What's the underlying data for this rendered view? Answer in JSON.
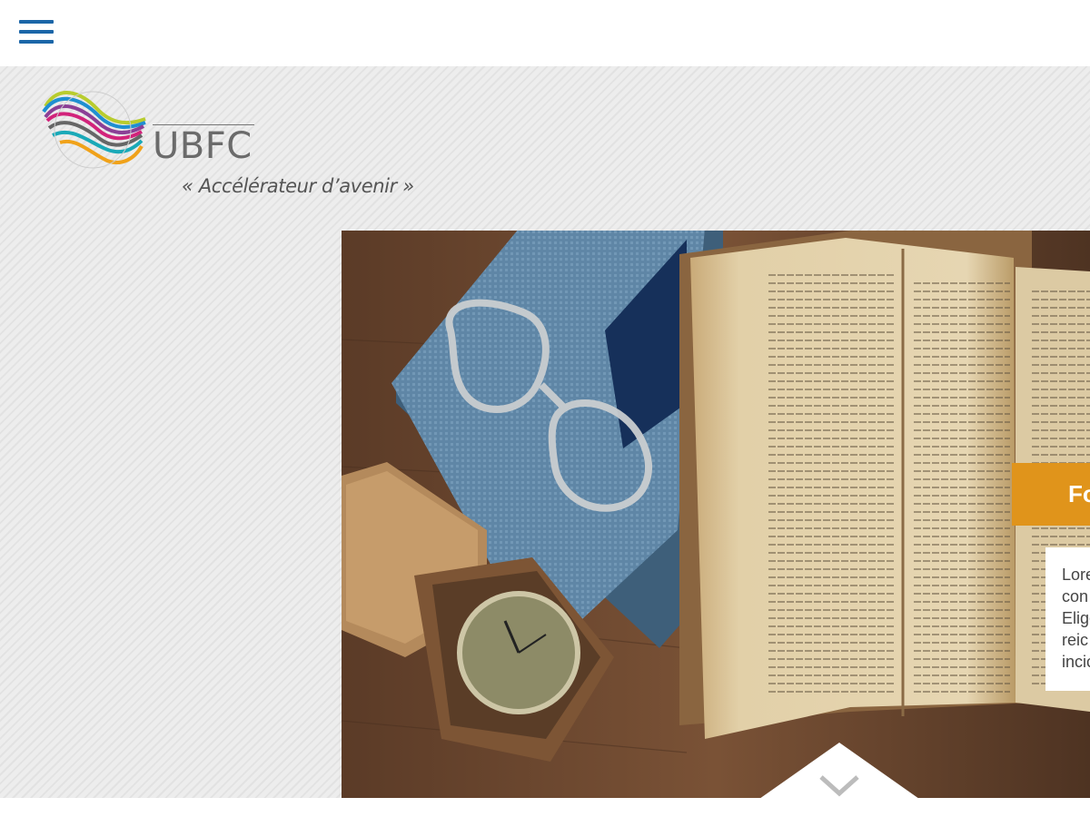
{
  "header": {
    "menu_icon": "hamburger-menu-icon",
    "accent_color": "#1b66a8"
  },
  "logo": {
    "name": "UBFC",
    "tagline": "« Accélérateur d’avenir »",
    "icon": "ubfc-wave-logo"
  },
  "hero": {
    "image": "books-glasses-clock-photo",
    "caption_title": "Fo",
    "caption_text": "Lore con Elige reic incic",
    "caption_color": "#e0941b",
    "scroll_icon": "chevron-down-icon"
  }
}
